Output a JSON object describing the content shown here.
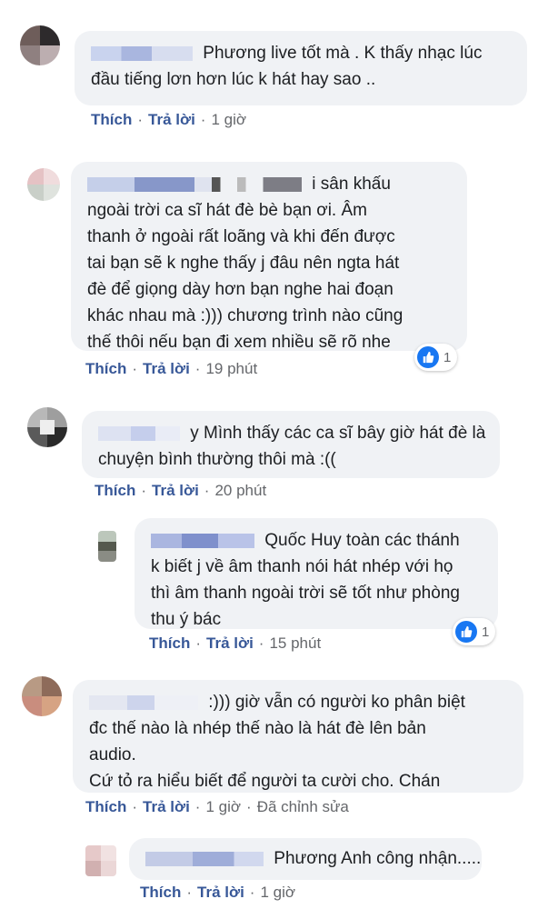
{
  "comments": [
    {
      "text_lines": [
        "Phương live tốt mà . K thấy nhạc lúc",
        "đầu tiếng lơn hơn lúc k hát hay sao .."
      ],
      "like": "Thích",
      "reply": "Trả lời",
      "time": "1 giờ"
    },
    {
      "text_lines": [
        "i sân khấu",
        "ngoài trời ca sĩ hát đè bè bạn ơi. Âm",
        "thanh ở ngoài rất loãng và khi đến được",
        "tai bạn sẽ k nghe thấy j đâu nên ngta hát",
        "đè để giọng dày hơn bạn nghe hai đoạn",
        "khác nhau mà :))) chương trình nào cũng",
        "thế thôi nếu bạn đi xem nhiều sẽ rõ nhe"
      ],
      "like": "Thích",
      "reply": "Trả lời",
      "time": "19 phút",
      "reaction_count": "1"
    },
    {
      "text_lines": [
        "y Mình thấy các ca sĩ bây giờ hát đè là",
        "chuyện bình thường thôi mà :(("
      ],
      "like": "Thích",
      "reply": "Trả lời",
      "time": "20 phút"
    },
    {
      "text_lines": [
        "Quốc Huy toàn các thánh",
        "k biết j về âm thanh nói hát nhép với họ",
        "thì âm thanh ngoài trời sẽ tốt như phòng",
        "thu ý bác"
      ],
      "like": "Thích",
      "reply": "Trả lời",
      "time": "15 phút",
      "reaction_count": "1"
    },
    {
      "text_lines": [
        ":))) giờ vẫn có người ko phân biệt",
        "đc thế nào là nhép thế nào là hát đè lên bản",
        "audio.",
        "Cứ tỏ ra hiểu biết để người ta cười cho. Chán"
      ],
      "like": "Thích",
      "reply": "Trả lời",
      "time": "1 giờ",
      "edited": "Đã chỉnh sửa"
    },
    {
      "text_lines": [
        "Phương Anh công nhận....."
      ],
      "like": "Thích",
      "reply": "Trả lời",
      "time": "1 giờ"
    }
  ],
  "colors": {
    "link": "#385898",
    "bubble": "#f0f2f5",
    "like_blue": "#1877f2"
  },
  "icons": [
    "like-icon"
  ]
}
